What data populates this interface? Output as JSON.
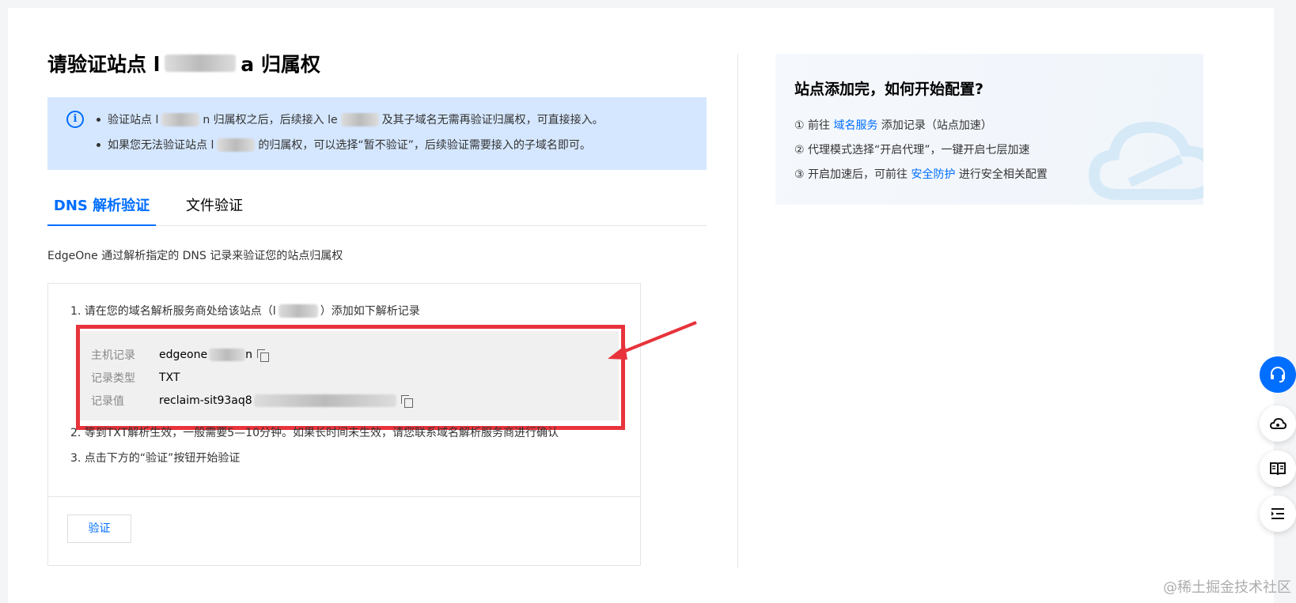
{
  "page": {
    "title_prefix": "请验证站点 l",
    "title_suffix": "a 归属权"
  },
  "info": {
    "line1_a": "验证站点 l",
    "line1_b": "n 归属权之后，后续接入 le",
    "line1_c": "及其子域名无需再验证归属权，可直接接入。",
    "line2_a": "如果您无法验证站点 l",
    "line2_b": "的归属权，可以选择“暂不验证”，后续验证需要接入的子域名即可。"
  },
  "tabs": [
    {
      "label": "DNS 解析验证",
      "active": true
    },
    {
      "label": "文件验证",
      "active": false
    }
  ],
  "description": "EdgeOne 通过解析指定的 DNS 记录来验证您的站点归属权",
  "steps": {
    "step1_a": "1. 请在您的域名解析服务商处给该站点（l",
    "step1_b": "）添加如下解析记录",
    "step2": "2. 等到TXT解析生效，一般需要5—10分钟。如果长时间未生效，请您联系域名解析服务商进行确认",
    "step3": "3. 点击下方的“验证”按钮开始验证"
  },
  "record": {
    "host_label": "主机记录",
    "host_value": "edgeone",
    "host_suffix": "n",
    "type_label": "记录类型",
    "type_value": "TXT",
    "value_label": "记录值",
    "value_value": "reclaim-sit93aq8"
  },
  "verify_button": "验证",
  "guide": {
    "title": "站点添加完，如何开始配置?",
    "item1_prefix": "① 前往 ",
    "item1_link": "域名服务",
    "item1_suffix": " 添加记录（站点加速）",
    "item2": "② 代理模式选择“开启代理”，一键开启七层加速",
    "item3_prefix": "③ 开启加速后，可前往 ",
    "item3_link": "安全防护",
    "item3_suffix": " 进行安全相关配置"
  },
  "watermark": "@稀土掘金技术社区",
  "colors": {
    "accent": "#006eff",
    "highlight_frame": "#e8333b",
    "info_bg": "#d5e7ff"
  },
  "icons": [
    "info-icon",
    "copy-icon",
    "headset-icon",
    "cloud-icon",
    "book-icon",
    "list-indent-icon"
  ]
}
